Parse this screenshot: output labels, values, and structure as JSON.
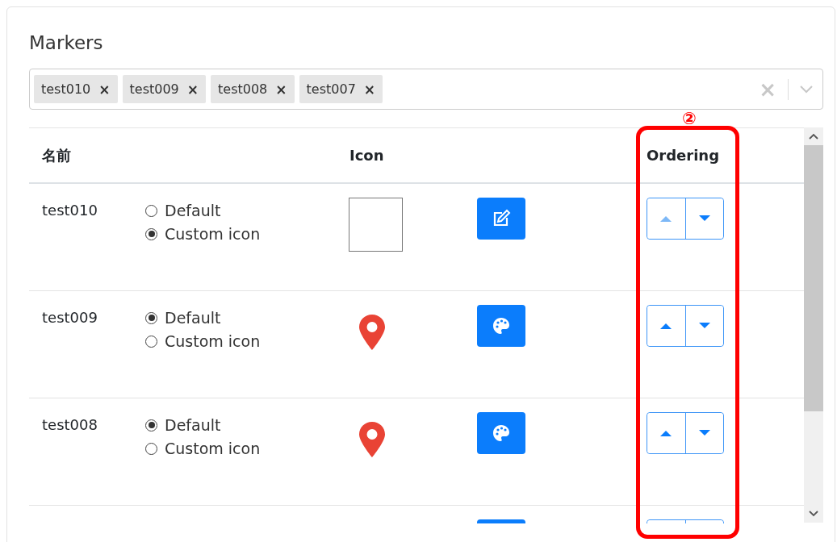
{
  "title": "Markers",
  "select": {
    "tags": [
      "test010",
      "test009",
      "test008",
      "test007"
    ],
    "remove_mark": "×",
    "clear_mark": "×"
  },
  "table": {
    "columns": [
      "名前",
      "Icon",
      "Ordering"
    ],
    "rows": [
      {
        "kind": "custom",
        "name": "test010",
        "options": [
          {
            "label": "Default",
            "selected": false
          },
          {
            "label": "Custom icon",
            "selected": true
          }
        ],
        "up_disabled": true
      },
      {
        "kind": "default",
        "name": "test009",
        "options": [
          {
            "label": "Default",
            "selected": true
          },
          {
            "label": "Custom icon",
            "selected": false
          }
        ],
        "up_disabled": false
      },
      {
        "kind": "default",
        "name": "test008",
        "options": [
          {
            "label": "Default",
            "selected": true
          },
          {
            "label": "Custom icon",
            "selected": false
          }
        ],
        "up_disabled": false
      },
      {
        "kind": "default"
      }
    ]
  },
  "annotation": {
    "label": "②"
  }
}
